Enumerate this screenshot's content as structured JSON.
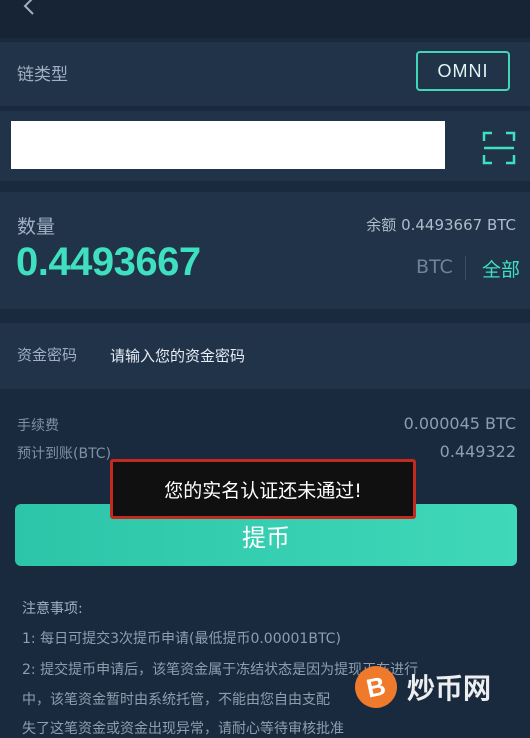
{
  "chain": {
    "label": "链类型",
    "selected": "OMNI"
  },
  "address": {
    "value": "",
    "placeholder": ""
  },
  "amount": {
    "label": "数量",
    "balance": "余额 0.4493667 BTC",
    "value": "0.4493667",
    "unit": "BTC",
    "all_label": "全部"
  },
  "password": {
    "label": "资金密码",
    "placeholder": "请输入您的资金密码"
  },
  "fee": {
    "label": "手续费",
    "value": "0.000045 BTC"
  },
  "estimate": {
    "label": "预计到账(BTC)",
    "value": "0.449322"
  },
  "withdraw_button": "提币",
  "toast": "您的实名认证还未通过!",
  "notes": {
    "title": "注意事项:",
    "items": [
      "1: 每日可提交3次提币申请(最低提币0.00001BTC)",
      "2: 提交提币申请后，该笔资金属于冻结状态是因为提现正在进行",
      "中，该笔资金暂时由系统托管，不能由您自由支配",
      "失了这笔资金或资金出现异常，请耐心等待审核批准"
    ]
  },
  "watermark": {
    "text": "炒币网",
    "coin": "B"
  },
  "colors": {
    "accent": "#3fe0bf",
    "background": "#1a2a3e",
    "panel": "#203349",
    "toast_border": "#c4281f"
  },
  "icons": {
    "back": "chevron-left-icon",
    "scan": "scan-icon"
  }
}
